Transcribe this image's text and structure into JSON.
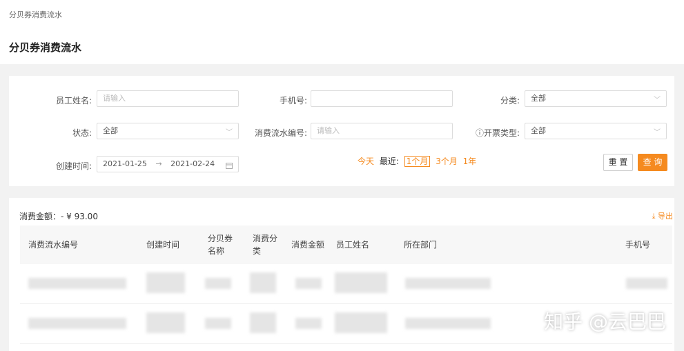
{
  "breadcrumb": "分贝券消费流水",
  "page_title": "分贝券消费流水",
  "filters": {
    "employee_name": {
      "label": "员工姓名:",
      "placeholder": "请输入"
    },
    "phone": {
      "label": "手机号:",
      "value": ""
    },
    "category": {
      "label": "分类:",
      "value": "全部"
    },
    "status": {
      "label": "状态:",
      "value": "全部"
    },
    "serial_no": {
      "label": "消费流水编号:",
      "placeholder": "请输入"
    },
    "invoice_type": {
      "label": "ⓘ开票类型:",
      "value": "全部"
    },
    "created_time": {
      "label": "创建时间:",
      "start": "2021-01-25",
      "arrow": "→",
      "end": "2021-02-24"
    },
    "quick": {
      "today": "今天",
      "recent": "最近:",
      "m1": "1个月",
      "m3": "3个月",
      "y1": "1年"
    },
    "reset_label": "重 置",
    "search_label": "查 询"
  },
  "summary": {
    "amount": "消费金额：- ¥ 93.00",
    "export": "导出"
  },
  "table": {
    "columns": [
      "消费流水编号",
      "创建时间",
      "分贝券名称",
      "消费分类",
      "消费金额",
      "员工姓名",
      "所在部门",
      "手机号"
    ]
  },
  "watermark": "知乎 @云巴巴",
  "colors": {
    "accent": "#f58a1f"
  }
}
